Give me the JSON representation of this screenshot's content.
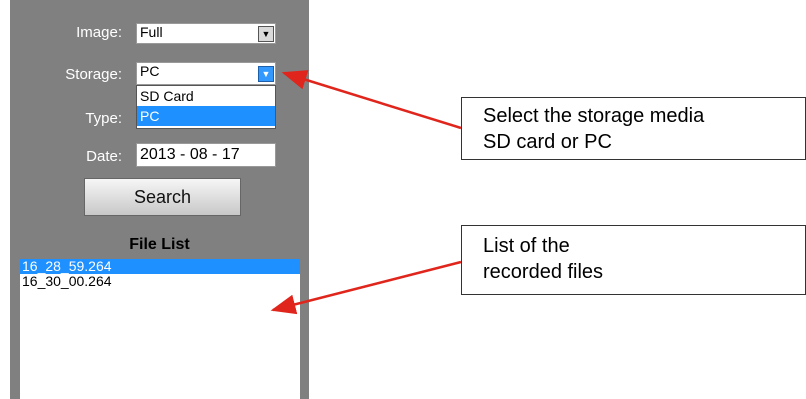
{
  "form": {
    "image_label": "Image:",
    "image_value": "Full",
    "storage_label": "Storage:",
    "storage_value": "PC",
    "storage_options": [
      "SD Card",
      "PC"
    ],
    "type_label": "Type:",
    "date_label": "Date:",
    "date_value": "2013 - 08 - 17",
    "search_label": "Search"
  },
  "file_list": {
    "title": "File List",
    "items": [
      "16_28_59.264",
      "16_30_00.264"
    ]
  },
  "callouts": {
    "storage": [
      "Select the storage media",
      "SD card or PC"
    ],
    "files": [
      "List of the",
      "recorded files"
    ]
  },
  "colors": {
    "panel": "#808080",
    "selection": "#1e90ff",
    "arrow": "#e0261c"
  }
}
